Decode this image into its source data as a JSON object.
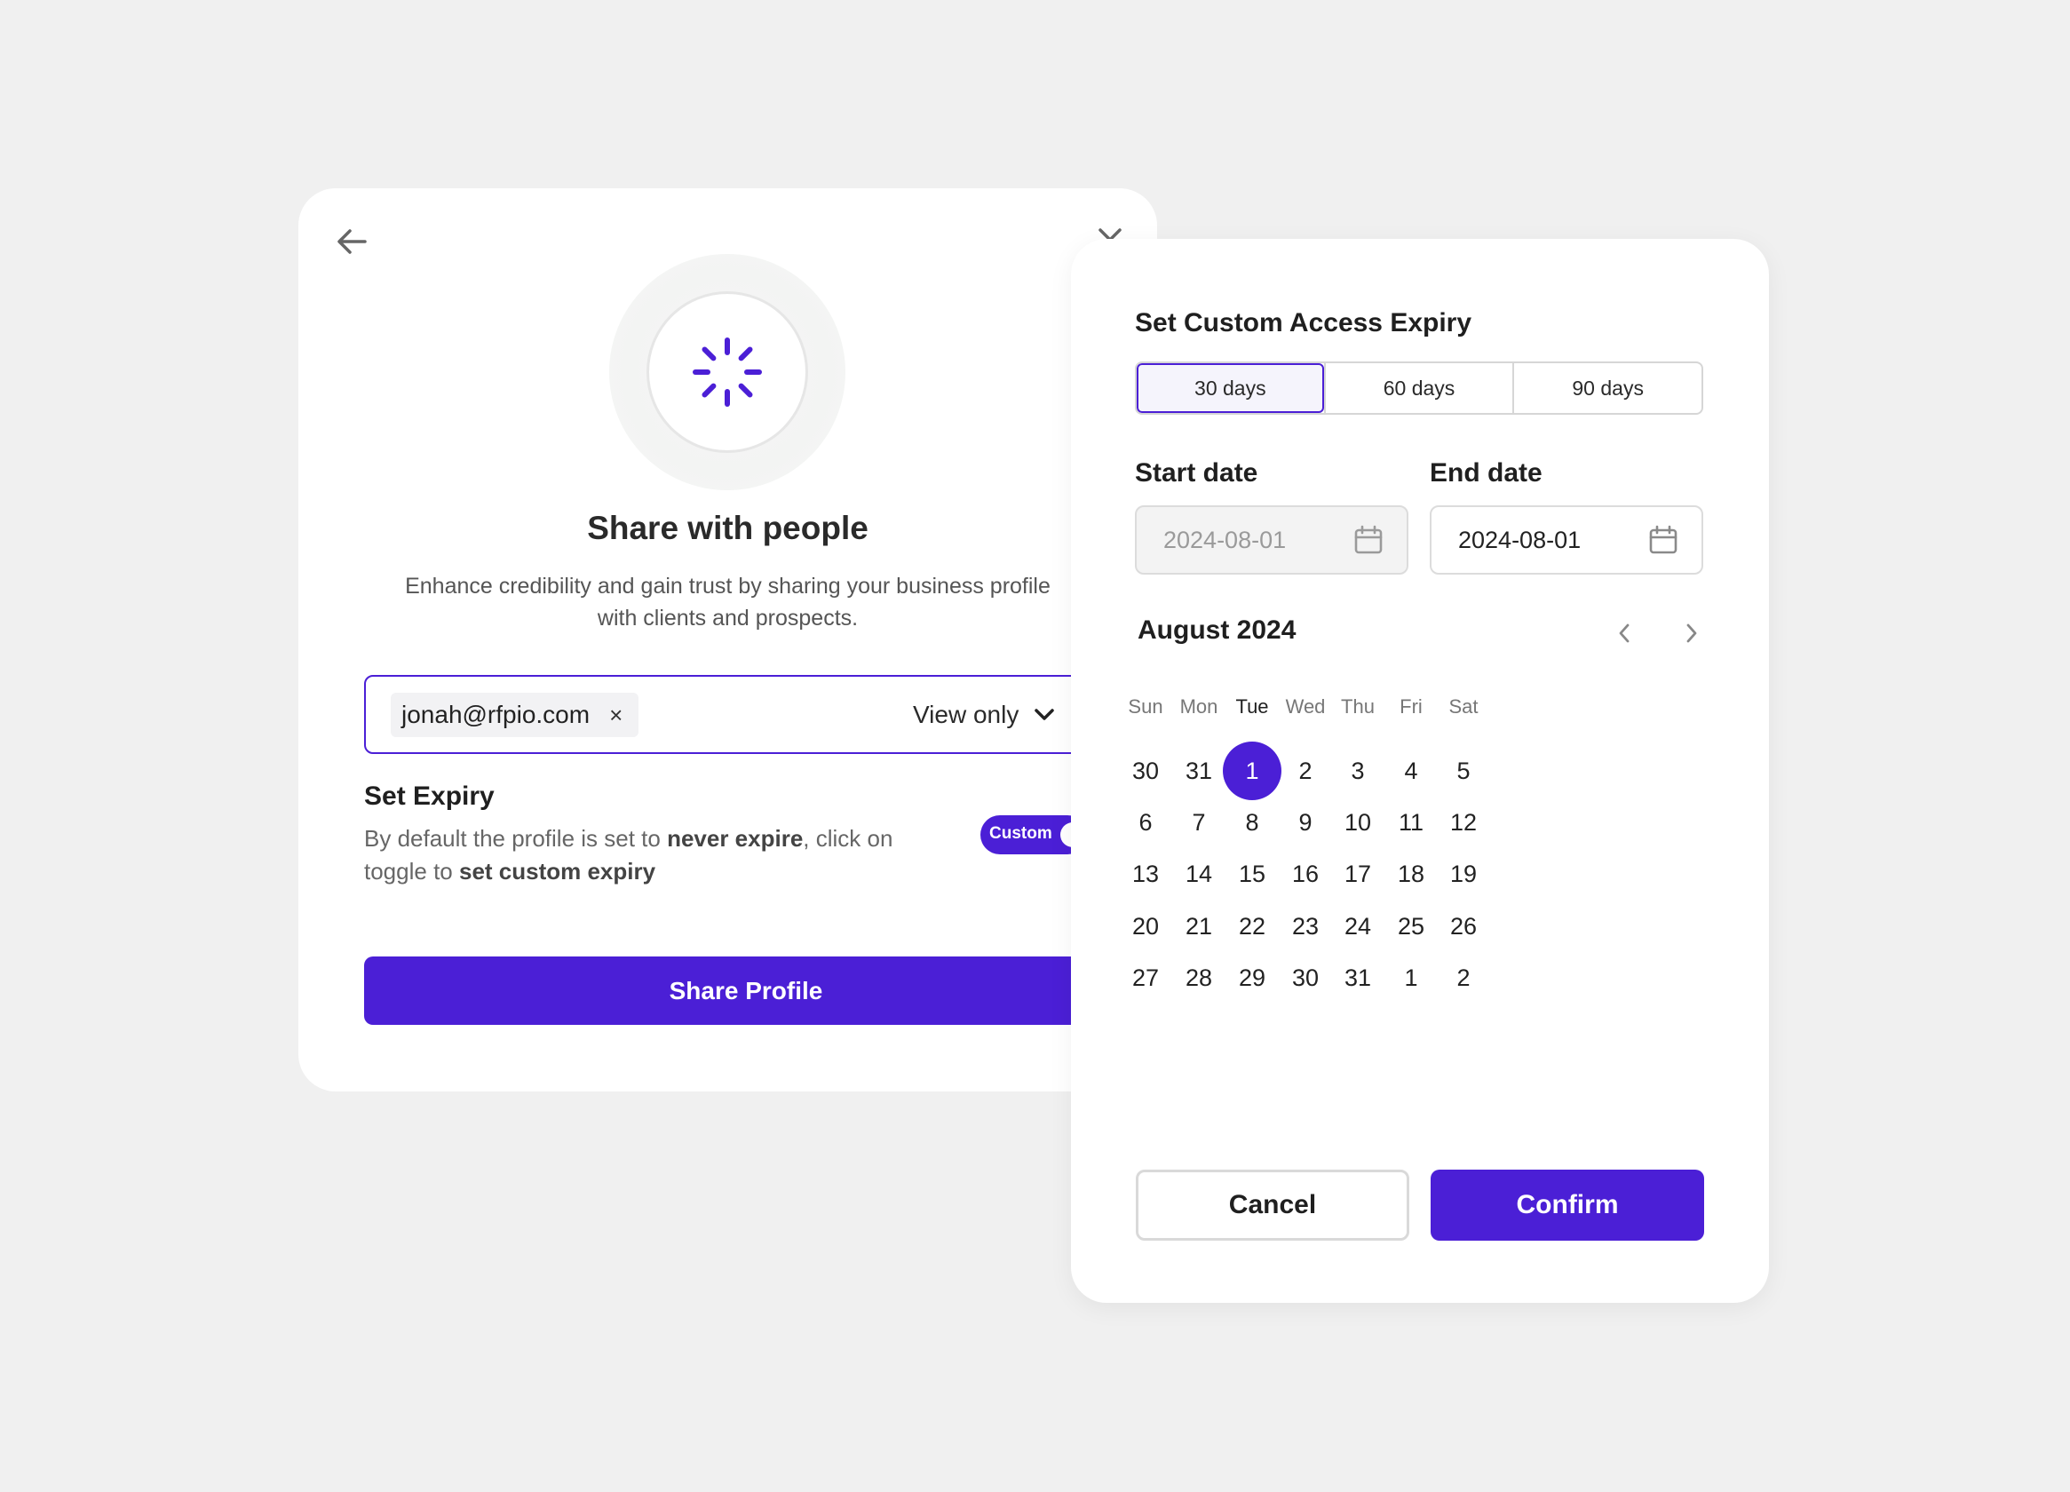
{
  "colors": {
    "accent": "#4b1fd6",
    "background": "#f0f0f0",
    "card": "#ffffff"
  },
  "share": {
    "title": "Share with people",
    "description": "Enhance credibility and gain trust by sharing your business profile with clients and prospects.",
    "recipient_chip": "jonah@rfpio.com",
    "chip_remove": "×",
    "permission": "View only",
    "expiry_title": "Set Expiry",
    "expiry_text_1": "By default the profile is set to ",
    "expiry_bold_1": "never expire",
    "expiry_text_2": ", click on toggle to ",
    "expiry_bold_2": "set custom expiry",
    "toggle_label": "Custom",
    "share_button": "Share Profile",
    "icons": [
      "arrow-left-icon",
      "close-icon",
      "loading-spinner-icon",
      "chevron-down-icon"
    ]
  },
  "expiry": {
    "title": "Set Custom Access Expiry",
    "presets": [
      "30 days",
      "60 days",
      "90 days"
    ],
    "selected_preset": "30 days",
    "start_label": "Start date",
    "start_value": "2024-08-01",
    "end_label": "End date",
    "end_value": "2024-08-01",
    "month": "August 2024",
    "weekdays": [
      "Sun",
      "Mon",
      "Tue",
      "Wed",
      "Thu",
      "Fri",
      "Sat"
    ],
    "highlight_weekday": "Tue",
    "weeks": [
      [
        "30",
        "31",
        "1",
        "2",
        "3",
        "4",
        "5"
      ],
      [
        "6",
        "7",
        "8",
        "9",
        "10",
        "11",
        "12"
      ],
      [
        "13",
        "14",
        "15",
        "16",
        "17",
        "18",
        "19"
      ],
      [
        "20",
        "21",
        "22",
        "23",
        "24",
        "25",
        "26"
      ],
      [
        "27",
        "28",
        "29",
        "30",
        "31",
        "1",
        "2"
      ]
    ],
    "selected_day": "1",
    "cancel": "Cancel",
    "confirm": "Confirm",
    "icons": [
      "calendar-icon",
      "chevron-left-icon",
      "chevron-right-icon"
    ]
  }
}
